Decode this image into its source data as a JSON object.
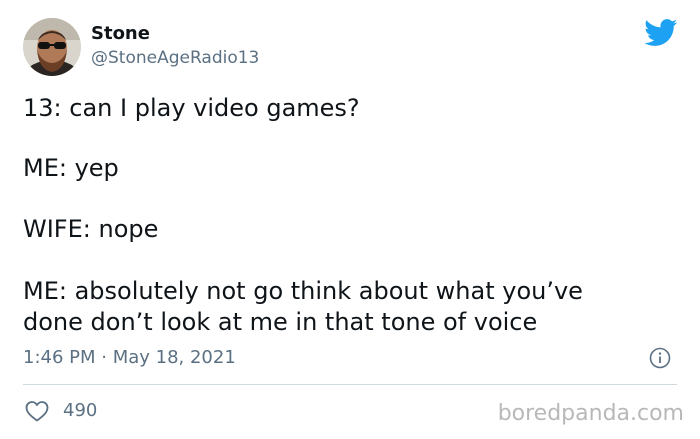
{
  "tweet": {
    "display_name": "Stone",
    "handle": "@StoneAgeRadio13",
    "avatar_icon": "avatar-photo-man-with-sunglasses",
    "platform_icon": "twitter-bird-icon",
    "lines": [
      "13: can I play video games?",
      "ME: yep",
      "WIFE: nope",
      "ME: absolutely not go think about what you’ve\ndone don’t look at me in that tone of voice"
    ],
    "timestamp": "1:46 PM · May 18, 2021",
    "like_count": "490"
  },
  "watermark": "boredpanda.com",
  "colors": {
    "text": "#0f1419",
    "secondary": "#5b7083",
    "twitter_blue": "#1da1f2",
    "divider": "#cfd9de",
    "watermark": "#b8b8b8"
  }
}
